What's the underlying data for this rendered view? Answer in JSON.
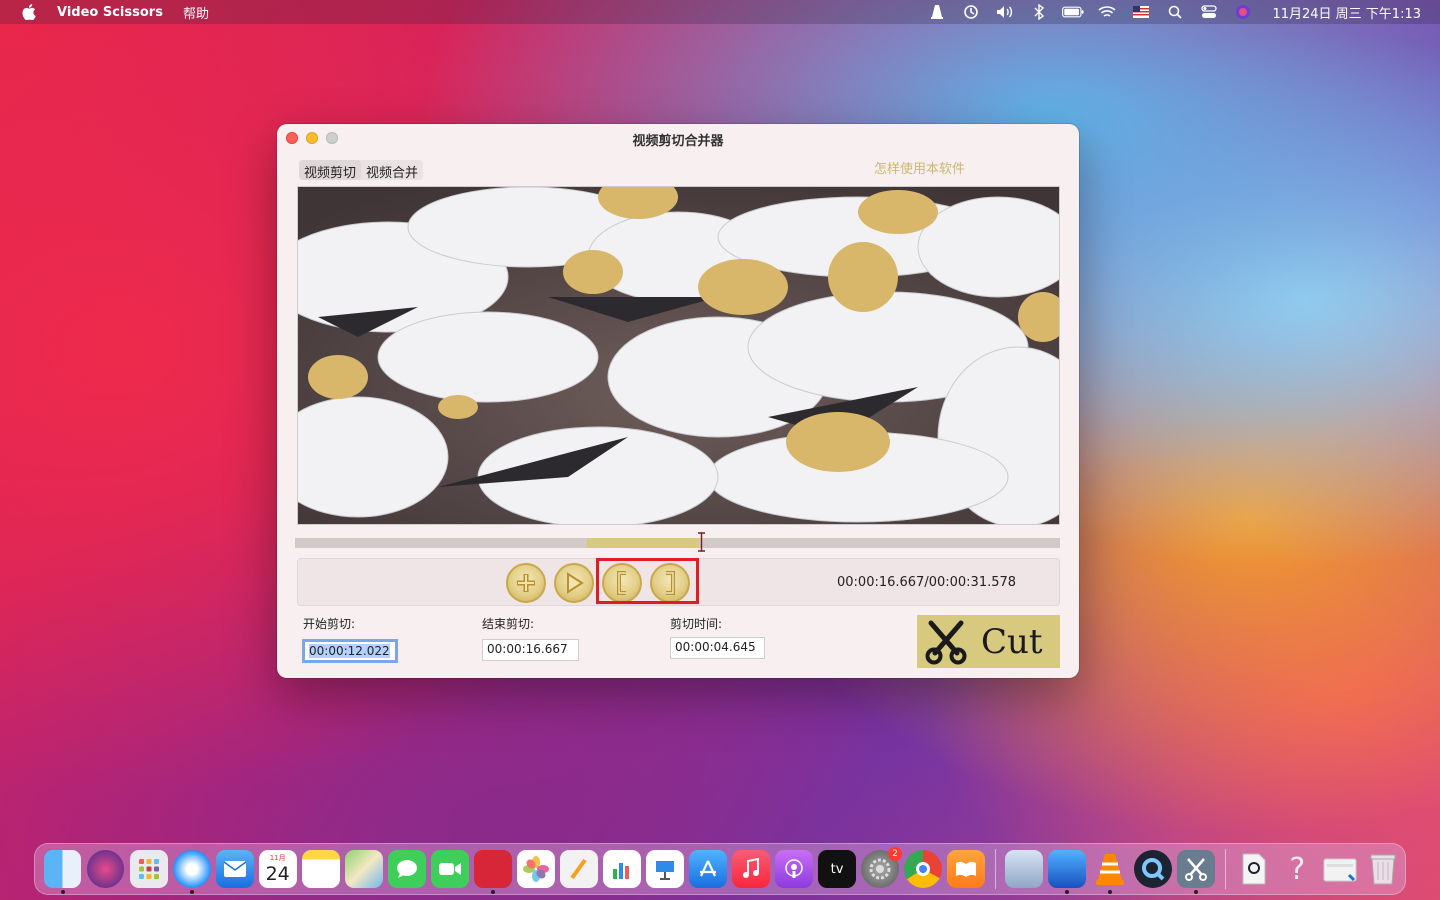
{
  "menubar": {
    "app_name": "Video Scissors",
    "menu_help": "帮助",
    "clock": "11月24日 周三 下午1:13",
    "status_icons": [
      "vlc-icon",
      "time-machine-icon",
      "volume-icon",
      "bluetooth-icon",
      "battery-icon",
      "wifi-icon",
      "flag-icon",
      "spotlight-icon",
      "control-center-icon",
      "siri-icon"
    ]
  },
  "window": {
    "title": "视频剪切合并器",
    "tabs": [
      {
        "label": "视频剪切",
        "active": true
      },
      {
        "label": "视频合并",
        "active": false
      }
    ],
    "help_link": "怎样使用本软件",
    "time_readout": "00:00:16.667/00:00:31.578",
    "fields": {
      "start_label": "开始剪切:",
      "start_value": "00:00:12.022",
      "end_label": "结束剪切:",
      "end_value": "00:00:16.667",
      "duration_label": "剪切时间:",
      "duration_value": "00:00:04.645"
    },
    "cut_label": "Cut",
    "accent_color": "#d7ca7e",
    "highlight_color": "#e31b23"
  },
  "dock": {
    "calendar_month": "11月",
    "calendar_day": "24",
    "settings_badge": "2",
    "apps": [
      "finder-icon",
      "siri-icon",
      "launchpad-icon",
      "safari-icon",
      "mail-icon",
      "calendar-icon",
      "notes-icon",
      "maps-icon",
      "messages-icon",
      "facetime-icon",
      "photo-booth-icon",
      "photos-icon",
      "pages-icon",
      "numbers-icon",
      "keynote-icon",
      "app-store-icon",
      "music-icon",
      "podcasts-icon",
      "apple-tv-icon",
      "system-preferences-icon",
      "chrome-icon",
      "books-icon",
      "preview-icon",
      "xcode-icon",
      "vlc-icon",
      "quicktime-icon",
      "video-scissors-icon",
      "mp4-file-icon",
      "help-icon",
      "folder-icon",
      "trash-icon"
    ]
  }
}
